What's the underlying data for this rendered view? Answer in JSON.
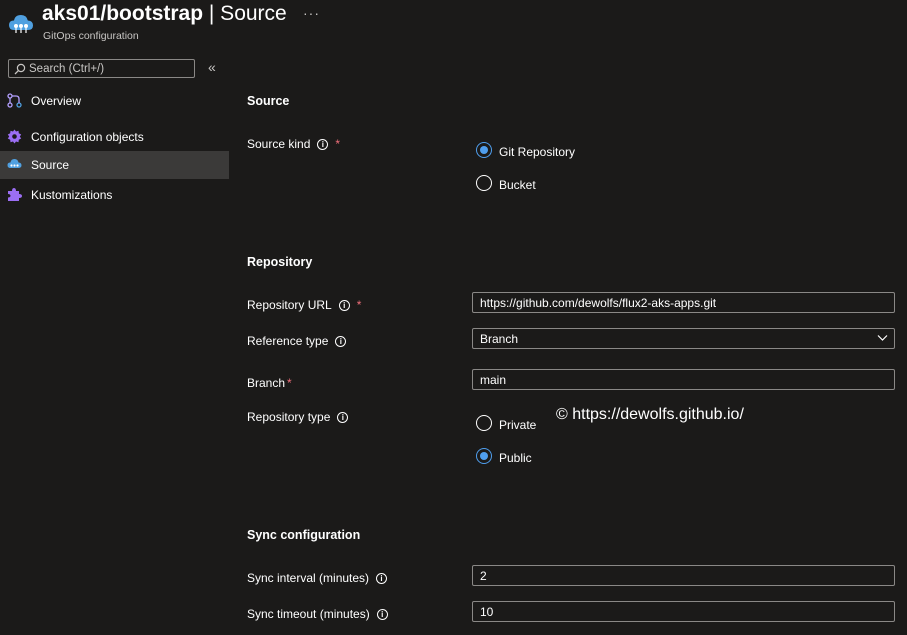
{
  "header": {
    "title_bold": "aks01/bootstrap",
    "title_rest": " | Source",
    "subtitle": "GitOps configuration",
    "more": "···"
  },
  "search": {
    "placeholder": "Search (Ctrl+/)",
    "collapse": "«"
  },
  "nav": {
    "items": [
      {
        "label": "Overview",
        "icon": "overview-icon"
      },
      {
        "label": "Configuration objects",
        "icon": "gear-icon"
      },
      {
        "label": "Source",
        "icon": "cloud-icon",
        "selected": true
      },
      {
        "label": "Kustomizations",
        "icon": "puzzle-icon"
      }
    ]
  },
  "form": {
    "source": {
      "heading": "Source",
      "kind_label": "Source kind",
      "options": [
        "Git Repository",
        "Bucket"
      ],
      "selected": "Git Repository"
    },
    "repository": {
      "heading": "Repository",
      "url_label": "Repository URL",
      "url_value": "https://github.com/dewolfs/flux2-aks-apps.git",
      "ref_type_label": "Reference type",
      "ref_type_value": "Branch",
      "branch_label": "Branch",
      "branch_value": "main",
      "repo_type_label": "Repository type",
      "repo_type_options": [
        "Private",
        "Public"
      ],
      "repo_type_selected": "Public"
    },
    "sync": {
      "heading": "Sync configuration",
      "interval_label": "Sync interval (minutes)",
      "interval_value": "2",
      "timeout_label": "Sync timeout (minutes)",
      "timeout_value": "10"
    },
    "required_mark": "*",
    "info_glyph": "i"
  },
  "watermark": "© https://dewolfs.github.io/",
  "colors": {
    "accent": "#4f9eed",
    "required": "#f1707b",
    "selected_bg": "#3b3a39",
    "background": "#1b1a19"
  }
}
